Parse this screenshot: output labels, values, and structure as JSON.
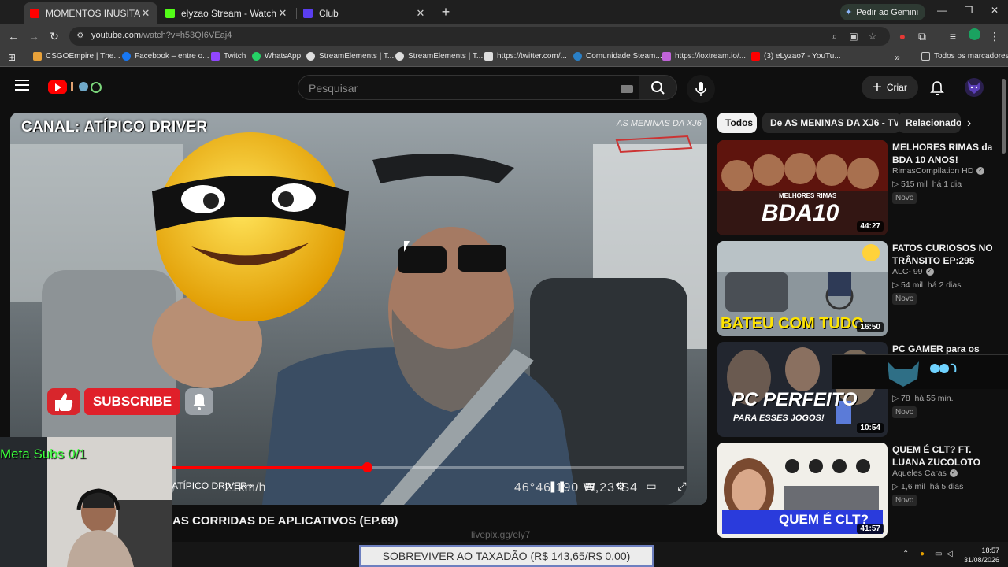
{
  "browser": {
    "tabs": [
      {
        "title": "MOMENTOS INUSITADOS NAS",
        "active": true,
        "favicon_color": "#ff0000"
      },
      {
        "title": "elyzao Stream - Watch Live on",
        "active": false,
        "favicon_color": "#53fc18"
      },
      {
        "title": "Club",
        "active": false,
        "favicon_color": "#5a3ef0"
      }
    ],
    "gemini_label": "Pedir ao Gemini",
    "url_host": "youtube.com",
    "url_path": "/watch?v=h53QI6VEaj4",
    "bookmarks": [
      {
        "label": "CSGOEmpire | The...",
        "color": "#e8a23a"
      },
      {
        "label": "Facebook – entre o...",
        "color": "#1877f2"
      },
      {
        "label": "Twitch",
        "color": "#9146ff"
      },
      {
        "label": "WhatsApp",
        "color": "#25d366"
      },
      {
        "label": "StreamElements | T...",
        "color": "#dddddd"
      },
      {
        "label": "StreamElements | T...",
        "color": "#dddddd"
      },
      {
        "label": "https://twitter.com/...",
        "color": "#dddddd"
      },
      {
        "label": "Comunidade Steam...",
        "color": "#2a80c7"
      },
      {
        "label": "https://ioxtream.io/...",
        "color": "#c064d8"
      },
      {
        "label": "(3) eLyzao7 - YouTu...",
        "color": "#ff0000"
      }
    ],
    "all_bookmarks_label": "Todos os marcadores"
  },
  "youtube": {
    "search_placeholder": "Pesquisar",
    "create_label": "Criar",
    "player": {
      "channel_overlay": "CANAL: ATÍPICO DRIVER",
      "watermark": "AS MENINAS DA XJ6",
      "subscribe_label": "SUBSCRIBE",
      "chapter_label": "ATÍPICO DRIVER",
      "speed_text": "21km/h",
      "coord_text": "46°46.190 W,23°S4",
      "progress": 0.38
    },
    "video_title": "AS CORRIDAS DE APLICATIVOS (EP.69)",
    "chips": [
      "Todos",
      "De AS MENINAS DA XJ6 - TV",
      "Relacionado"
    ],
    "recommendations": [
      {
        "title": "MELHORES RIMAS da BDA 10 ANOS!",
        "channel": "RimasCompilation HD",
        "views": "515 mil",
        "age": "há 1 dia",
        "badge": "Novo",
        "duration": "44:27",
        "thumb_text": "BDA10",
        "thumb_sub": "MELHORES RIMAS",
        "thumb_color": "#7a1d12"
      },
      {
        "title": "FATOS CURIOSOS NO TRÂNSITO EP:295",
        "channel": "ALC- 99",
        "views": "54 mil",
        "age": "há 2 dias",
        "badge": "Novo",
        "duration": "16:50",
        "thumb_text": "BATEU COM TUDO",
        "thumb_sub": "",
        "thumb_color": "#5b6670"
      },
      {
        "title": "PC GAMER para os",
        "channel": "",
        "views": "78",
        "age": "há 55 min.",
        "badge": "Novo",
        "duration": "10:54",
        "thumb_text": "PC PERFEITO",
        "thumb_sub": "PARA ESSES JOGOS!",
        "thumb_color": "#2b2f3b"
      },
      {
        "title": "QUEM É CLT? FT. LUANA ZUCOLOTO",
        "channel": "Aqueles Caras",
        "views": "1,6 mil",
        "age": "há 5 dias",
        "badge": "Novo",
        "duration": "41:57",
        "thumb_text": "QUEM É CLT?",
        "thumb_sub": "",
        "thumb_color": "#8a2aa0"
      }
    ]
  },
  "stream_overlay": {
    "meta_subs": "Meta Subs 0/1",
    "ticker": "SOBREVIVER AO TAXADÃO (R$ 143,65/R$ 0,00)",
    "livepix": "livepix.gg/ely7"
  },
  "system": {
    "time": "18:57",
    "date": "31/08/2026"
  }
}
